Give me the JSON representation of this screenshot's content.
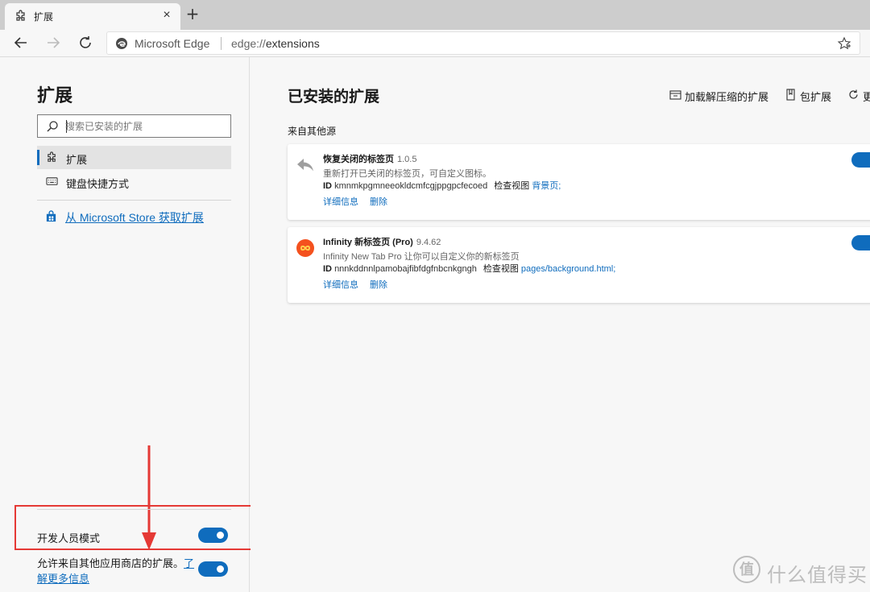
{
  "browser": {
    "tab": {
      "title": "扩展",
      "icon": "puzzle-icon"
    },
    "new_tab_label": "+",
    "close_label": "×",
    "address": {
      "site_name": "Microsoft Edge",
      "url_scheme": "edge://",
      "url_path": "extensions"
    }
  },
  "sidebar": {
    "title": "扩展",
    "search_placeholder": "搜索已安装的扩展",
    "items": [
      {
        "label": "扩展",
        "icon": "puzzle-icon",
        "active": true
      },
      {
        "label": "键盘快捷方式",
        "icon": "keyboard-icon",
        "active": false
      }
    ],
    "store_link": {
      "label": "从 Microsoft Store 获取扩展",
      "icon": "store-bag-icon"
    },
    "developer_mode": {
      "label": "开发人员模式",
      "enabled": true
    },
    "allow_other_stores": {
      "text": "允许来自其他应用商店的扩展。",
      "link": "了解更多信息",
      "enabled": true
    }
  },
  "main": {
    "title": "已安装的扩展",
    "actions": [
      {
        "label": "加载解压缩的扩展",
        "icon": "load-unpacked-icon"
      },
      {
        "label": "包扩展",
        "icon": "pack-icon"
      },
      {
        "label": "更",
        "icon": "refresh-icon"
      }
    ],
    "section_label": "来自其他源",
    "extensions": [
      {
        "name": "恢复关闭的标签页",
        "version": "1.0.5",
        "description": "重新打开已关闭的标签页，可自定义图标。",
        "id_label": "ID",
        "id": "kmnmkpgmneeokldcmfcgjppgpcfecoed",
        "inspect_label": "检查视图",
        "inspect_link": "背景页;",
        "details_label": "详细信息",
        "remove_label": "删除",
        "icon": "undo-arrow-icon",
        "enabled": true
      },
      {
        "name": "Infinity 新标签页 (Pro)",
        "version": "9.4.62",
        "description": "Infinity New Tab Pro 让你可以自定义你的新标签页",
        "id_label": "ID",
        "id": "nnnkddnnlpamobajfibfdgfnbcnkgngh",
        "inspect_label": "检查视图",
        "inspect_link": "pages/background.html;",
        "details_label": "详细信息",
        "remove_label": "删除",
        "icon": "infinity-icon",
        "enabled": true
      }
    ]
  },
  "watermark": {
    "badge": "值",
    "text": "什么值得买"
  },
  "colors": {
    "accent": "#0f6cbd",
    "annotation": "#e53935",
    "infinity_icon": "#f4511e"
  }
}
